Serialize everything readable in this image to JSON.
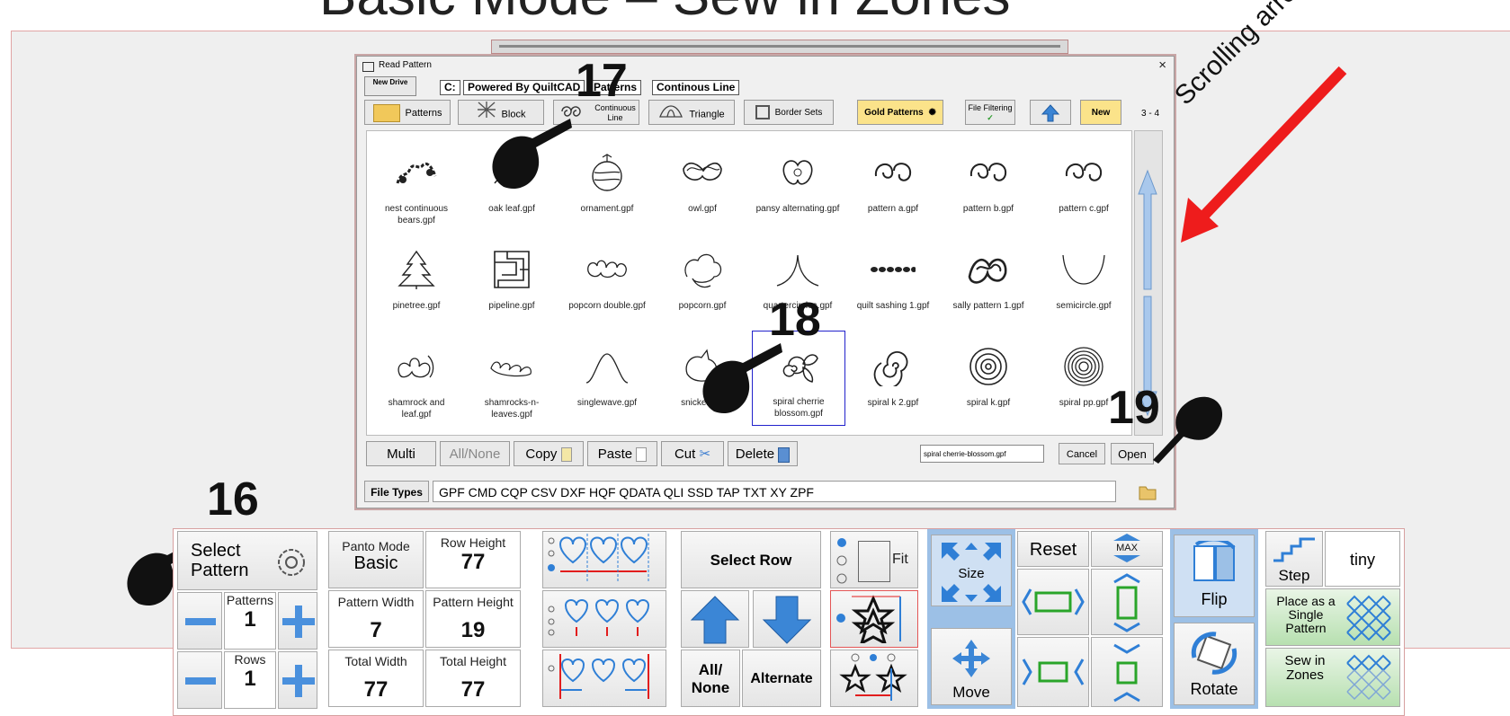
{
  "page_title": "Basic Mode – Sew in Zones",
  "annotations": {
    "scrolling": "Scrolling arrows",
    "n16": "16",
    "n17": "17",
    "n18": "18",
    "n19": "19"
  },
  "dialog": {
    "title": "Read Pattern",
    "close": "×",
    "new_drive": "New Drive",
    "drive_letter": "C:",
    "path_folder": "Powered By QuiltCAD",
    "path_sub1": "Patterns",
    "path_sub2": "Continous Line",
    "tabs": {
      "patterns": "Patterns",
      "block": "Block",
      "continuous": "Continuous Line",
      "triangle": "Triangle",
      "border": "Border Sets",
      "gold": "Gold Patterns",
      "filtering": "File Filtering",
      "new": "New"
    },
    "page_indicator": "3 - 4",
    "files": [
      "nest continuous bears.gpf",
      "oak leaf.gpf",
      "ornament.gpf",
      "owl.gpf",
      "pansy alternating.gpf",
      "pattern a.gpf",
      "pattern b.gpf",
      "pattern c.gpf",
      "pinetree.gpf",
      "pipeline.gpf",
      "popcorn double.gpf",
      "popcorn.gpf",
      "quartercircles.gpf",
      "quilt sashing 1.gpf",
      "sally pattern 1.gpf",
      "semicircle.gpf",
      "shamrock and leaf.gpf",
      "shamrocks-n-leaves.gpf",
      "singlewave.gpf",
      "snicker.gpf",
      "spiral cherrie blossom.gpf",
      "spiral k 2.gpf",
      "spiral k.gpf",
      "spiral pp.gpf"
    ],
    "buttons": {
      "multi": "Multi",
      "allnone": "All/None",
      "copy": "Copy",
      "paste": "Paste",
      "cut": "Cut",
      "delete": "Delete",
      "cancel": "Cancel",
      "open": "Open"
    },
    "filename_value": "spiral cherrie-blossom.gpf",
    "file_types_label": "File Types",
    "file_types_value": "GPF CMD CQP CSV DXF HQF QDATA QLI SSD TAP TXT XY ZPF"
  },
  "toolbar": {
    "select_pattern": "Select Pattern",
    "patterns_label": "Patterns",
    "patterns_value": "1",
    "rows_label": "Rows",
    "rows_value": "1",
    "panto_label": "Panto Mode",
    "panto_value": "Basic",
    "row_height_label": "Row Height",
    "row_height_value": "77",
    "pattern_width_label": "Pattern Width",
    "pattern_width_value": "7",
    "pattern_height_label": "Pattern Height",
    "pattern_height_value": "19",
    "total_width_label": "Total Width",
    "total_width_value": "77",
    "total_height_label": "Total Height",
    "total_height_value": "77",
    "select_row": "Select Row",
    "all_none": "All/ None",
    "alternate": "Alternate",
    "fit": "Fit",
    "size": "Size",
    "reset": "Reset",
    "max": "MAX",
    "move": "Move",
    "flip": "Flip",
    "rotate": "Rotate",
    "step": "Step",
    "step_value": "tiny",
    "place_single": "Place as a Single Pattern",
    "sew_zones": "Sew in Zones"
  },
  "colors": {
    "accent_blue": "#2f7fd6",
    "panel_blue": "#9cc0e6",
    "arrow_red": "#ee1c1c",
    "select_green": "#b7e0b0"
  }
}
